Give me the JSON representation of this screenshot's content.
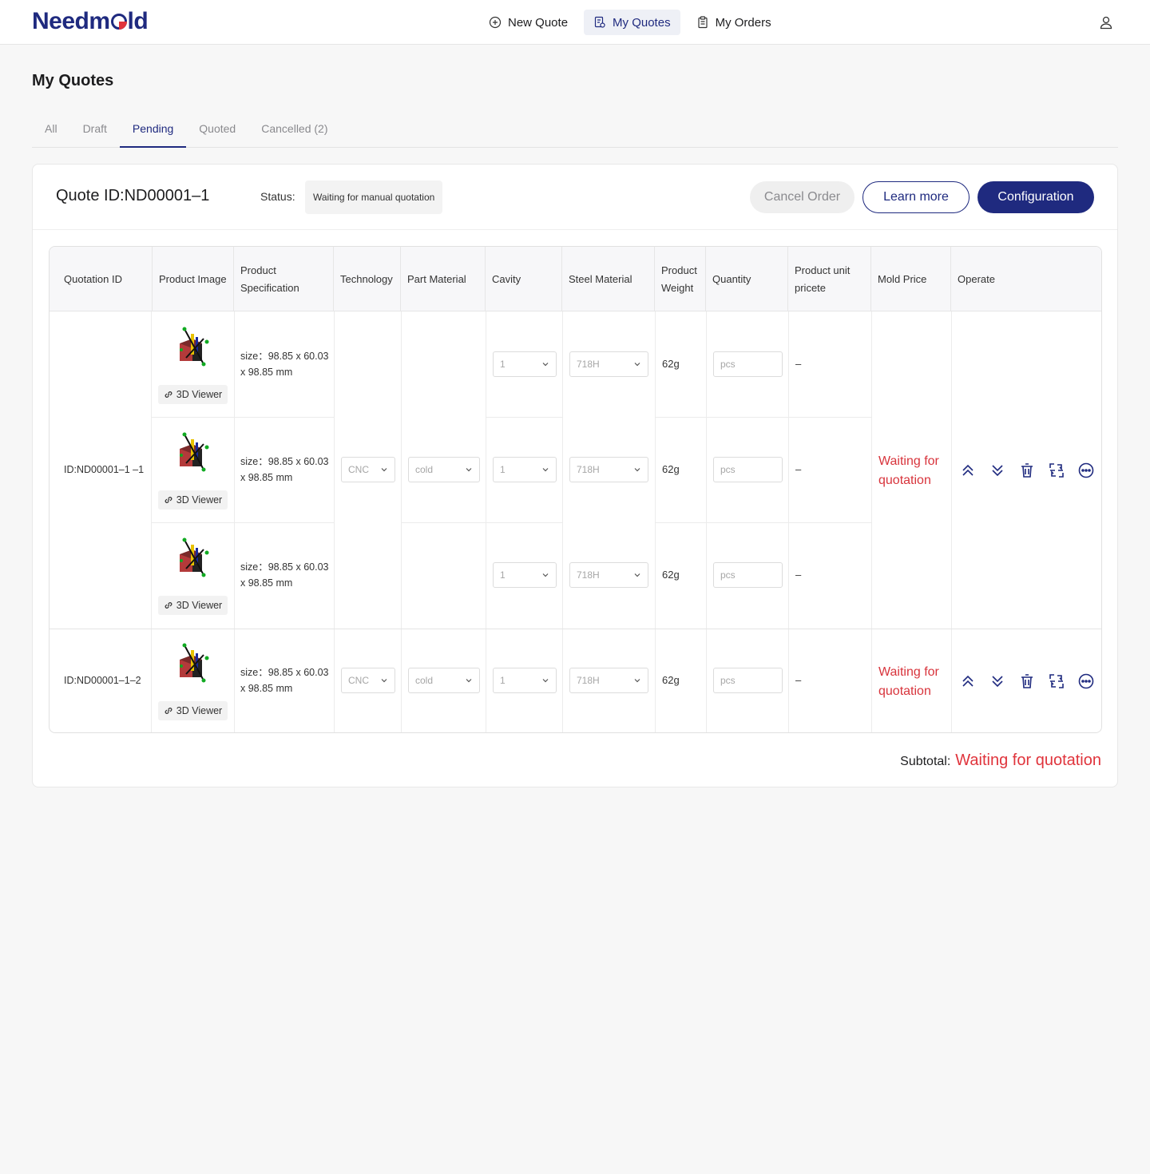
{
  "app": {
    "logo_text_1": "Need",
    "logo_text_2": "ld",
    "logo_letter_m": "m"
  },
  "nav": {
    "items": [
      {
        "label": "New Quote",
        "icon": "plus-circle-icon"
      },
      {
        "label": "My Quotes",
        "icon": "quote-doc-icon",
        "active": true
      },
      {
        "label": "My Orders",
        "icon": "clipboard-icon"
      }
    ]
  },
  "page": {
    "title": "My Quotes"
  },
  "tabs": [
    {
      "label": "All"
    },
    {
      "label": "Draft"
    },
    {
      "label": "Pending",
      "active": true
    },
    {
      "label": "Quoted"
    },
    {
      "label": "Cancelled (2)"
    }
  ],
  "quote": {
    "id_label": "Quote ID:ND00001–1",
    "status_label": "Status:",
    "status_value": "Waiting for manual quotation",
    "cancel_label": "Cancel Order",
    "learn_label": "Learn more",
    "config_label": "Configuration"
  },
  "table": {
    "headers": [
      "Quotation ID",
      "Product Image",
      "Product Specification",
      "Technology",
      "Part Material",
      "Cavity",
      "Steel Material",
      "Product Weight",
      "Quantity",
      "Product unit pricete",
      "Mold Price",
      "Operate"
    ],
    "viewer_label": "3D Viewer",
    "spec_text": "size：98.85 x 60.03 x 98.85 mm",
    "groups": [
      {
        "id": "ID:ND00001–1 –1",
        "technology": "CNC",
        "material": "cold",
        "mold_price": "Waiting for quotation",
        "rows": [
          {
            "cavity": "1",
            "steel": "718H",
            "weight": "62g",
            "qty_placeholder": "pcs",
            "unit_price": "–"
          },
          {
            "cavity": "1",
            "steel": "718H",
            "weight": "62g",
            "qty_placeholder": "pcs",
            "unit_price": "–"
          },
          {
            "cavity": "1",
            "steel": "718H",
            "weight": "62g",
            "qty_placeholder": "pcs",
            "unit_price": "–"
          }
        ]
      },
      {
        "id": "ID:ND00001–1–2",
        "technology": "CNC",
        "material": "cold",
        "mold_price": "Waiting for quotation",
        "rows": [
          {
            "cavity": "1",
            "steel": "718H",
            "weight": "62g",
            "qty_placeholder": "pcs",
            "unit_price": "–"
          }
        ]
      }
    ]
  },
  "subtotal": {
    "label": "Subtotal:",
    "value": "Waiting for quotation"
  },
  "colors": {
    "brand": "#1f2a7f",
    "accent_red": "#e0343c"
  }
}
